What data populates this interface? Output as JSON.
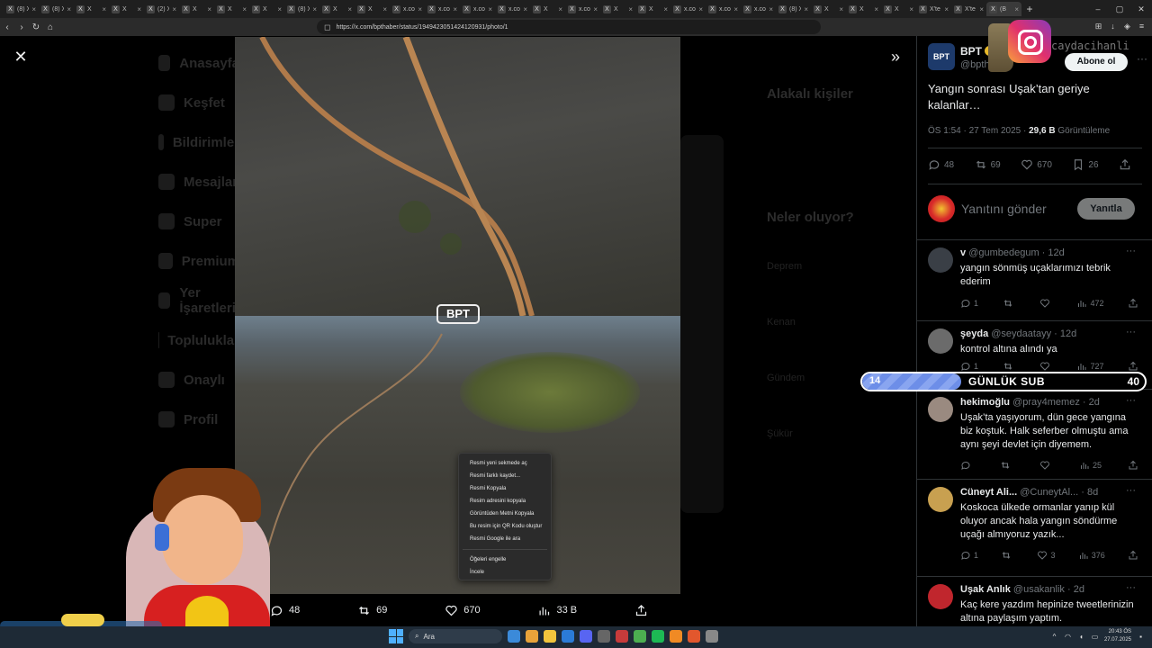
{
  "browser": {
    "tabs": [
      {
        "label": "(8) X"
      },
      {
        "label": "(8) X"
      },
      {
        "label": "X"
      },
      {
        "label": "X"
      },
      {
        "label": "(2) X"
      },
      {
        "label": "X"
      },
      {
        "label": "X"
      },
      {
        "label": "X"
      },
      {
        "label": "(8) X"
      },
      {
        "label": "X"
      },
      {
        "label": "X"
      },
      {
        "label": "x.com"
      },
      {
        "label": "x.com"
      },
      {
        "label": "x.com"
      },
      {
        "label": "x.com"
      },
      {
        "label": "X"
      },
      {
        "label": "x.com"
      },
      {
        "label": "X"
      },
      {
        "label": "X"
      },
      {
        "label": "x.com"
      },
      {
        "label": "x.com"
      },
      {
        "label": "x.com"
      },
      {
        "label": "(8) X"
      },
      {
        "label": "X"
      },
      {
        "label": "X"
      },
      {
        "label": "X"
      },
      {
        "label": "X'te"
      },
      {
        "label": "X'te"
      },
      {
        "label": "(B"
      }
    ],
    "active_tab_index": 28,
    "url": "https://x.com/bpthaber/status/1949423051424120931/photo/1"
  },
  "background": {
    "nav": [
      "Anasayfa",
      "Keşfet",
      "Bildirimler",
      "Mesajlar",
      "Super",
      "Premium",
      "Yer İşaretleri",
      "Topluluklar",
      "Onaylı",
      "Profil"
    ],
    "right_heading_1": "Alakalı kişiler",
    "right_heading_2": "Neler oluyor?",
    "right_rows": [
      "Deprem",
      "Kenan",
      "Gündem",
      "Şükür"
    ],
    "messages_label": "Mesa"
  },
  "context_menu": {
    "items": [
      "Resmi yeni sekmede aç",
      "Resmi farklı kaydet...",
      "Resmi Kopyala",
      "Resim adresini kopyala",
      "Görüntüden Metni Kopyala",
      "Bu resim için QR Kodu oluştur",
      "Resmi Google ile ara"
    ],
    "items_after_sep": [
      "Öğeleri engelle",
      "İncele"
    ]
  },
  "photo": {
    "watermark": "BPT",
    "actions": {
      "replies": "48",
      "reposts": "69",
      "likes": "670",
      "views": "33 B"
    }
  },
  "tweet": {
    "author_name": "BPT",
    "author_handle": "@bpth",
    "avatar_text": "BPT",
    "follow_label": "Abone ol",
    "text": "Yangın sonrası Uşak’tan geriye kalanlar…",
    "time": "ÖS 1:54 · 27 Tem 2025 · ",
    "views_count": "29,6 B",
    "views_label": " Görüntüleme",
    "stats": {
      "replies": "48",
      "reposts": "69",
      "likes": "670",
      "bookmarks": "26"
    },
    "reply_placeholder": "Yanıtını gönder",
    "reply_button": "Yanıtla"
  },
  "replies": [
    {
      "name": "v",
      "handle": "@gumbedegum · 12d",
      "text": "yangın sönmüş uçaklarımızı tebrik ederim",
      "replies": "1",
      "reposts": "",
      "likes": "",
      "views": "472"
    },
    {
      "name": "şeyda",
      "handle": "@seydaatayy · 12d",
      "text": "kontrol altına alındı ya",
      "replies": "1",
      "reposts": "",
      "likes": "",
      "views": "727"
    },
    {
      "name": "hekimoğlu",
      "handle": "@pray4memez · 2d",
      "text": "Uşak’ta yaşıyorum, dün gece yangına biz koştuk. Halk seferber olmuştu ama aynı şeyi devlet için diyemem.",
      "replies": "",
      "reposts": "",
      "likes": "",
      "views": "25"
    },
    {
      "name": "Cüneyt Ali...",
      "handle": "@CuneytAl... · 8d",
      "text": "Koskoca ülkede ormanlar yanıp kül oluyor ancak hala yangın söndürme uçağı almıyoruz yazık...",
      "replies": "1",
      "reposts": "",
      "likes": "3",
      "views": "376"
    },
    {
      "name": "Uşak Anlık",
      "handle": "@usakanlik · 2d",
      "text": "Kaç kere yazdım hepinize tweetlerinizin altına paylaşım yaptım.",
      "replies": "",
      "reposts": "",
      "likes": "",
      "views": ""
    }
  ],
  "overlay": {
    "sub_start": "14",
    "sub_label": "GÜNLÜK SUB",
    "sub_goal": "40",
    "sub_progress": 0.35,
    "instagram_handle": "caydacihanli"
  },
  "taskbar": {
    "search_placeholder": "Ara",
    "time": "20:43 ÖS",
    "date": "27.07.2025"
  },
  "colors": {
    "accent_blue": "#1d9bf0",
    "verified_gold": "#e8b92a",
    "sub_fill": "#7b9aec"
  }
}
